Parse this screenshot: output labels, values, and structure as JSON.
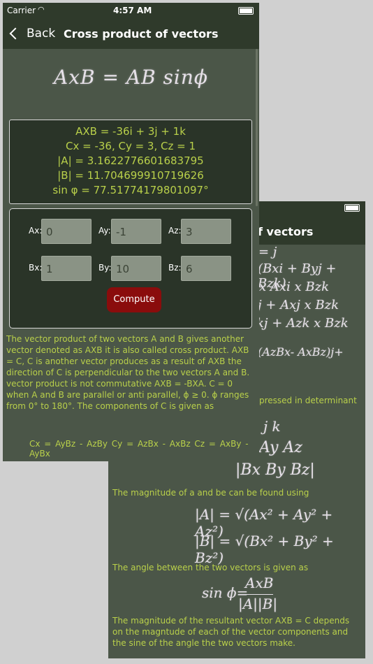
{
  "status": {
    "carrier": "Carrier",
    "time": "4:57 AM"
  },
  "nav": {
    "back_label": "Back",
    "title": "Cross product of vectors"
  },
  "back_screen": {
    "nav_title_fragment": "f vectors",
    "expansion_lines": [
      "(Bxi + Byj + Bzk)",
      "x Axi x Bzk",
      "j + Axj x Bzk",
      "kj + Azk x Bzk",
      "(AzBx- AxBz)j+"
    ],
    "determinant_text": "pressed in determinant",
    "determinant_rows": [
      "j   k",
      "Ay  Az",
      "|Bx  By  Bz|"
    ],
    "magnitude_text": "The magnitude of a and be can be found using",
    "magnitude_a": "|A| = √(Ax² + Ay² + Az²)",
    "magnitude_b": "|B| = √(Bx² + By² + Bz²)",
    "angle_text": "The angle between the two vectors is given as",
    "sin_label": "sin ϕ=",
    "sin_numerator": "AxB",
    "sin_denominator": "|A||B|",
    "result_text": "The magnitude of the resultant vector AXB = C depends on the magntude of each of the vector components and the sine of the angle the two vectors make."
  },
  "formula": "AxB = AB sinϕ",
  "results": {
    "line1": "AXB = -36i + 3j + 1k",
    "line2": "Cx = -36, Cy = 3, Cz = 1",
    "line3": "|A| = 3.1622776601683795",
    "line4": "|B| = 11.704699910719626",
    "line5": "sin φ = 77.51774179801097°"
  },
  "inputs": {
    "ax_label": "Ax:",
    "ax_value": "0",
    "ay_label": "Ay:",
    "ay_value": "-1",
    "az_label": "Az:",
    "az_value": "3",
    "bx_label": "Bx:",
    "bx_value": "1",
    "by_label": "By:",
    "by_value": "10",
    "bz_label": "Bz:",
    "bz_value": "6",
    "compute_label": "Compute"
  },
  "description": "The vector product of two vectors A and B gives another vector denoted as AXB it is also called cross product. AXB = C, C is another vector produces as a result of AXB the direction of C is perpendicular to the two vectors A and B. vector product is not commutative AXB = -BXA.  C = 0 when A and B are parallel or anti parallel, ϕ ≥ 0.  ϕ  ranges from 0° to 180°.    The components of C is given as",
  "components": "Cx = AyBz - AzBy    Cy = AzBx - AxBz    Cz = AxBy - AyBx"
}
